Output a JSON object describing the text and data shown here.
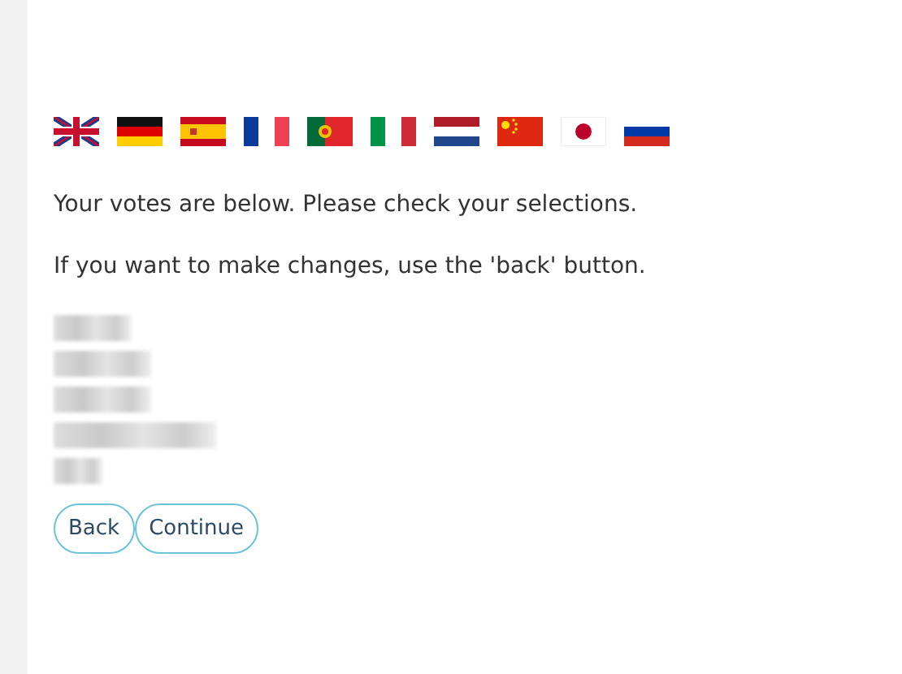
{
  "languages": [
    {
      "kind": "uk"
    },
    {
      "kind": "de"
    },
    {
      "kind": "es"
    },
    {
      "kind": "fr"
    },
    {
      "kind": "pt"
    },
    {
      "kind": "it"
    },
    {
      "kind": "nl"
    },
    {
      "kind": "cn"
    },
    {
      "kind": "jp"
    },
    {
      "kind": "ru"
    }
  ],
  "messages": [
    "Your votes are below. Please check your selections.",
    "If you want to make changes, use the 'back' button."
  ],
  "votes": [
    {
      "kind": "redacted"
    },
    {
      "kind": "redacted"
    },
    {
      "kind": "redacted"
    },
    {
      "kind": "redacted"
    },
    {
      "kind": "redacted"
    }
  ],
  "buttons": [
    "Back",
    "Continue"
  ]
}
